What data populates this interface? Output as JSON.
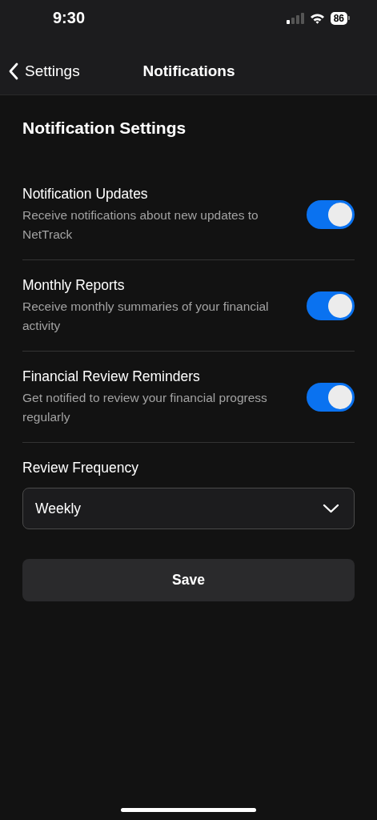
{
  "status_bar": {
    "time": "9:30",
    "battery": "86"
  },
  "nav": {
    "back_label": "Settings",
    "title": "Notifications"
  },
  "section_title": "Notification Settings",
  "settings": [
    {
      "title": "Notification Updates",
      "description": "Receive notifications about new updates to NetTrack",
      "on": true
    },
    {
      "title": "Monthly Reports",
      "description": "Receive monthly summaries of your financial activity",
      "on": true
    },
    {
      "title": "Financial Review Reminders",
      "description": "Get notified to review your financial progress regularly",
      "on": true
    }
  ],
  "frequency": {
    "label": "Review Frequency",
    "value": "Weekly"
  },
  "save_button": "Save"
}
